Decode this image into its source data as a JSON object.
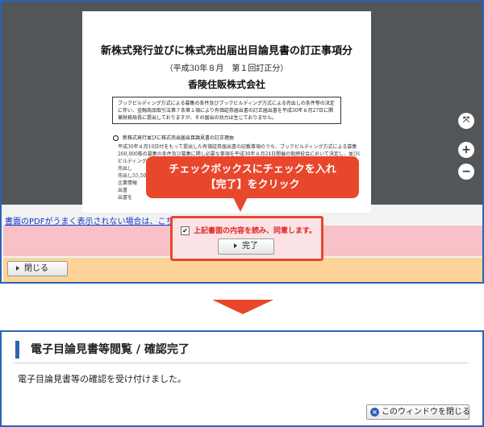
{
  "viewer": {
    "doc_title": "新株式発行並びに株式売出届出目論見書の訂正事項分",
    "doc_subtitle": "（平成30年８月　第１回訂正分）",
    "doc_company": "香陵住販株式会社",
    "doc_box_text": "ブックビルディング方式による募集の条件及びブックビルディング方式による売出しの条件等の決定に伴い、金融商品取引法第７条第１項により有価証券届出書の訂正届出書を平成30年８月27日に関東財務局長に提出しておりますが、その届出の効力は生じておりません。",
    "doc_heading": "新株式発行並びに株式売出届出目論見書の訂正理由",
    "doc_body": [
      "平成30年８月10日付をもって提出した有価証券届出書の記載事項のうち、ブックビルディング方式による募集",
      "260,000株の募集の条件及び募集に関し必要な事項を平成30年８月24日開催の取締役会において決定し、並びにブック",
      "ビルディング",
      "売出し",
      "売出し55,500",
      "企業情報",
      "出書",
      "出書を"
    ],
    "zoom_fit": "⤧",
    "zoom_in": "+",
    "zoom_out": "−"
  },
  "pdf_link_text": "書面のPDFがうまく表示されない場合は、こちらを",
  "agree_label": "上記書面の内容を読み、同意します。",
  "agree_checked": "✔",
  "complete_button": "完了",
  "close_button": "閉じる",
  "callout": {
    "line1": "チェックボックスにチェックを入れ",
    "line2": "【完了】をクリック"
  },
  "result": {
    "title": "電子目論見書等閲覧 / 確認完了",
    "message": "電子目論見書等の確認を受け付けました。",
    "close_window_button": "このウィンドウを閉じる",
    "close_icon": "×"
  },
  "colors": {
    "accent": "#e8472c",
    "border_blue": "#2a64b4",
    "pink_band": "#f7c1c7",
    "orange_band": "#fdd39a"
  }
}
